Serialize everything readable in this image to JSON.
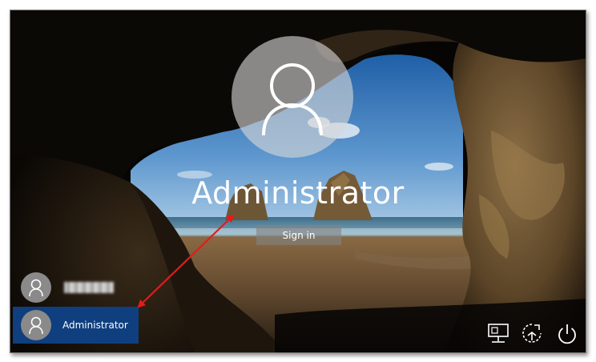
{
  "login": {
    "username": "Administrator",
    "signin_label": "Sign in"
  },
  "user_list": {
    "items": [
      {
        "label": "",
        "state": "blurred"
      },
      {
        "label": "Administrator",
        "state": "selected"
      }
    ]
  },
  "system_icons": [
    "network-icon",
    "ease-of-access-icon",
    "power-icon"
  ],
  "colors": {
    "selected_user_bg": "#0f3f7f",
    "annotation_arrow": "#e31b1b"
  }
}
